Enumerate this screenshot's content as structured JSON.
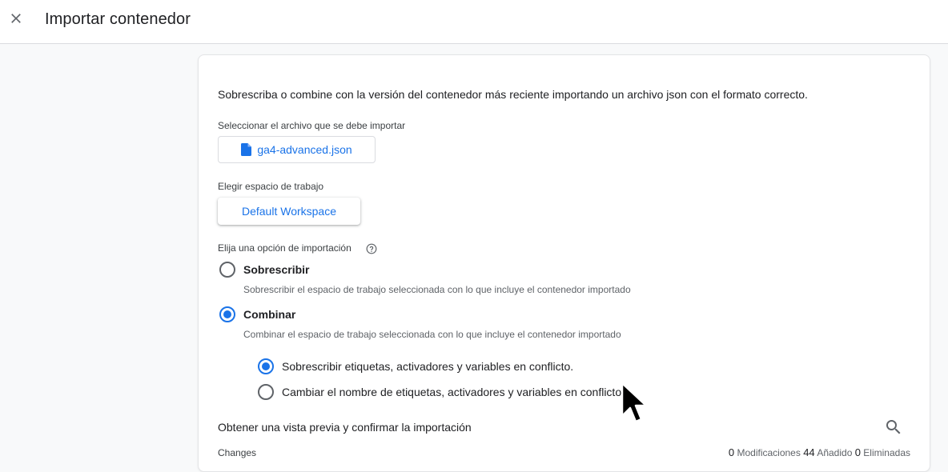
{
  "header": {
    "title": "Importar contenedor",
    "close_icon": "close-icon"
  },
  "main": {
    "intro": "Sobrescriba o combine con la versión del contenedor más reciente importando un archivo json con el formato correcto.",
    "file_section": {
      "label": "Seleccionar el archivo que se debe importar",
      "file_name": "ga4-advanced.json",
      "icon": "file-icon"
    },
    "workspace_section": {
      "label": "Elegir espacio de trabajo",
      "workspace_name": "Default Workspace"
    },
    "import_option": {
      "label": "Elija una opción de importación",
      "help_icon": "help-icon",
      "options": [
        {
          "title": "Sobrescribir",
          "description": "Sobrescribir el espacio de trabajo seleccionada con lo que incluye el contenedor importado",
          "selected": false
        },
        {
          "title": "Combinar",
          "description": "Combinar el espacio de trabajo seleccionada con lo que incluye el contenedor importado",
          "selected": true
        }
      ],
      "merge_options": [
        {
          "label": "Sobrescribir etiquetas, activadores y variables en conflicto.",
          "selected": true
        },
        {
          "label": "Cambiar el nombre de etiquetas, activadores y variables en conflicto.",
          "selected": false
        }
      ]
    },
    "preview": {
      "title": "Obtener una vista previa y confirmar la importación",
      "search_icon": "search-icon",
      "changes_label": "Changes",
      "modified_count": "0",
      "modified_label": "Modificaciones",
      "added_count": "44",
      "added_label": "Añadido",
      "deleted_count": "0",
      "deleted_label": "Eliminadas"
    }
  },
  "colors": {
    "accent": "#1a73e8",
    "text": "#202124",
    "muted": "#5f6368",
    "border": "#dadce0"
  }
}
